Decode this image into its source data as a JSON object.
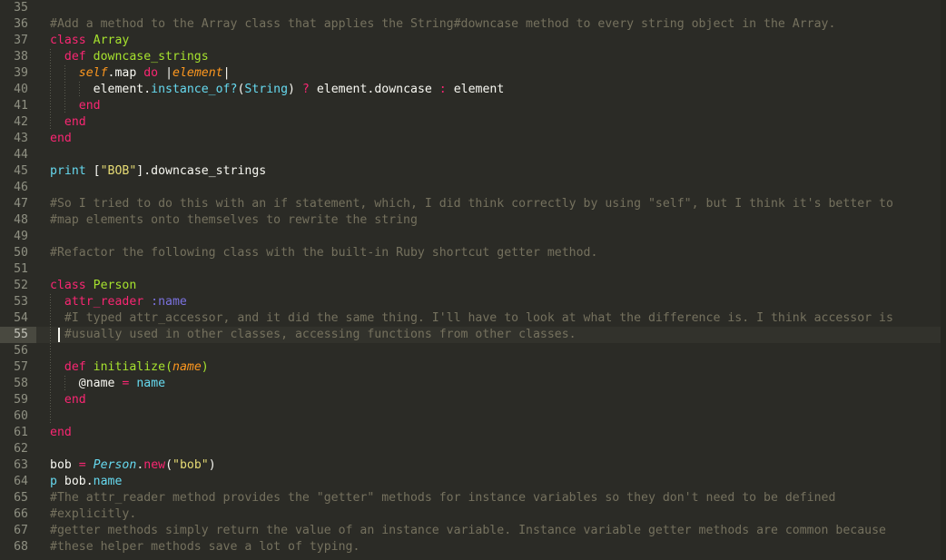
{
  "editor": {
    "theme_name": "monokai-dark",
    "background_color": "#2b2b26",
    "gutter_color": "#8f9082",
    "active_line_number": 55,
    "cursor_line": 55,
    "cursor_column": 2,
    "first_visible_line": 35,
    "last_visible_line": 68,
    "language": "ruby",
    "colors": {
      "comment": "#75715e",
      "keyword": "#f92672",
      "entity": "#a6e22e",
      "param": "#fd971f",
      "function": "#66d9ef",
      "string": "#e6db74",
      "symbol": "#7b72e0",
      "plain": "#f8f8f2",
      "active_line_bg": "#32322c",
      "active_gutter_bg": "#494940"
    }
  },
  "lines": [
    {
      "num": "35",
      "indent": 0,
      "active": false,
      "tokens": []
    },
    {
      "num": "36",
      "indent": 0,
      "active": false,
      "tokens": [
        {
          "t": "#Add a method to the Array class that applies the String#downcase method to every string object in the Array.",
          "c": "tok-comment"
        }
      ]
    },
    {
      "num": "37",
      "indent": 0,
      "active": false,
      "tokens": [
        {
          "t": "class ",
          "c": "tok-keyword"
        },
        {
          "t": "Array",
          "c": "tok-entity"
        }
      ]
    },
    {
      "num": "38",
      "indent": 1,
      "active": false,
      "tokens": [
        {
          "t": "  ",
          "c": "tok-plain"
        },
        {
          "t": "def ",
          "c": "tok-keyword"
        },
        {
          "t": "downcase_strings",
          "c": "tok-entity"
        }
      ]
    },
    {
      "num": "39",
      "indent": 2,
      "active": false,
      "tokens": [
        {
          "t": "    ",
          "c": "tok-plain"
        },
        {
          "t": "self",
          "c": "tok-param"
        },
        {
          "t": ".map ",
          "c": "tok-plain"
        },
        {
          "t": "do ",
          "c": "tok-keyword"
        },
        {
          "t": "|",
          "c": "tok-plain"
        },
        {
          "t": "element",
          "c": "tok-param"
        },
        {
          "t": "|",
          "c": "tok-plain"
        }
      ]
    },
    {
      "num": "40",
      "indent": 3,
      "active": false,
      "tokens": [
        {
          "t": "      element.",
          "c": "tok-plain"
        },
        {
          "t": "instance_of?",
          "c": "tok-func"
        },
        {
          "t": "(",
          "c": "tok-plain"
        },
        {
          "t": "String",
          "c": "tok-const"
        },
        {
          "t": ") ",
          "c": "tok-plain"
        },
        {
          "t": "?",
          "c": "tok-op"
        },
        {
          "t": " element.downcase ",
          "c": "tok-plain"
        },
        {
          "t": ":",
          "c": "tok-op"
        },
        {
          "t": " element",
          "c": "tok-plain"
        }
      ]
    },
    {
      "num": "41",
      "indent": 2,
      "active": false,
      "tokens": [
        {
          "t": "    ",
          "c": "tok-plain"
        },
        {
          "t": "end",
          "c": "tok-keyword"
        }
      ]
    },
    {
      "num": "42",
      "indent": 1,
      "active": false,
      "tokens": [
        {
          "t": "  ",
          "c": "tok-plain"
        },
        {
          "t": "end",
          "c": "tok-keyword"
        }
      ]
    },
    {
      "num": "43",
      "indent": 0,
      "active": false,
      "tokens": [
        {
          "t": "end",
          "c": "tok-keyword"
        }
      ]
    },
    {
      "num": "44",
      "indent": 0,
      "active": false,
      "tokens": []
    },
    {
      "num": "45",
      "indent": 0,
      "active": false,
      "tokens": [
        {
          "t": "print",
          "c": "tok-func"
        },
        {
          "t": " [",
          "c": "tok-plain"
        },
        {
          "t": "\"BOB\"",
          "c": "tok-string"
        },
        {
          "t": "].downcase_strings",
          "c": "tok-plain"
        }
      ]
    },
    {
      "num": "46",
      "indent": 0,
      "active": false,
      "tokens": []
    },
    {
      "num": "47",
      "indent": 0,
      "active": false,
      "tokens": [
        {
          "t": "#So I tried to do this with an if statement, which, I did think correctly by using \"self\", but I think it's better to",
          "c": "tok-comment"
        }
      ]
    },
    {
      "num": "48",
      "indent": 0,
      "active": false,
      "tokens": [
        {
          "t": "#map elements onto themselves to rewrite the string",
          "c": "tok-comment"
        }
      ]
    },
    {
      "num": "49",
      "indent": 0,
      "active": false,
      "tokens": []
    },
    {
      "num": "50",
      "indent": 0,
      "active": false,
      "tokens": [
        {
          "t": "#Refactor the following class with the built-in Ruby shortcut getter method.",
          "c": "tok-comment"
        }
      ]
    },
    {
      "num": "51",
      "indent": 0,
      "active": false,
      "tokens": []
    },
    {
      "num": "52",
      "indent": 0,
      "active": false,
      "tokens": [
        {
          "t": "class ",
          "c": "tok-keyword"
        },
        {
          "t": "Person",
          "c": "tok-entity"
        }
      ]
    },
    {
      "num": "53",
      "indent": 1,
      "active": false,
      "tokens": [
        {
          "t": "  ",
          "c": "tok-plain"
        },
        {
          "t": "attr_reader ",
          "c": "tok-keyword"
        },
        {
          "t": ":name",
          "c": "tok-symbol"
        }
      ]
    },
    {
      "num": "54",
      "indent": 1,
      "active": false,
      "tokens": [
        {
          "t": "  #I typed attr_accessor, and it did the same thing. I'll have to look at what the difference is. I think accessor is",
          "c": "tok-comment"
        }
      ]
    },
    {
      "num": "55",
      "indent": 1,
      "active": true,
      "tokens": [
        {
          "t": "  #usually used in other classes, accessing functions from other classes.",
          "c": "tok-comment"
        }
      ]
    },
    {
      "num": "56",
      "indent": 1,
      "active": false,
      "tokens": []
    },
    {
      "num": "57",
      "indent": 1,
      "active": false,
      "tokens": [
        {
          "t": "  ",
          "c": "tok-plain"
        },
        {
          "t": "def ",
          "c": "tok-keyword"
        },
        {
          "t": "initialize",
          "c": "tok-entity"
        },
        {
          "t": "(",
          "c": "tok-entity"
        },
        {
          "t": "name",
          "c": "tok-param"
        },
        {
          "t": ")",
          "c": "tok-entity"
        }
      ]
    },
    {
      "num": "58",
      "indent": 2,
      "active": false,
      "tokens": [
        {
          "t": "    @name ",
          "c": "tok-plain"
        },
        {
          "t": "=",
          "c": "tok-op"
        },
        {
          "t": " ",
          "c": "tok-plain"
        },
        {
          "t": "name",
          "c": "tok-cyan"
        }
      ]
    },
    {
      "num": "59",
      "indent": 1,
      "active": false,
      "tokens": [
        {
          "t": "  ",
          "c": "tok-plain"
        },
        {
          "t": "end",
          "c": "tok-keyword"
        }
      ]
    },
    {
      "num": "60",
      "indent": 1,
      "active": false,
      "tokens": []
    },
    {
      "num": "61",
      "indent": 0,
      "active": false,
      "tokens": [
        {
          "t": "end",
          "c": "tok-keyword"
        }
      ]
    },
    {
      "num": "62",
      "indent": 0,
      "active": false,
      "tokens": []
    },
    {
      "num": "63",
      "indent": 0,
      "active": false,
      "tokens": [
        {
          "t": "bob ",
          "c": "tok-plain"
        },
        {
          "t": "=",
          "c": "tok-op"
        },
        {
          "t": " ",
          "c": "tok-plain"
        },
        {
          "t": "Person",
          "c": "tok-type"
        },
        {
          "t": ".",
          "c": "tok-plain"
        },
        {
          "t": "new",
          "c": "tok-op"
        },
        {
          "t": "(",
          "c": "tok-plain"
        },
        {
          "t": "\"bob\"",
          "c": "tok-string"
        },
        {
          "t": ")",
          "c": "tok-plain"
        }
      ]
    },
    {
      "num": "64",
      "indent": 0,
      "active": false,
      "tokens": [
        {
          "t": "p",
          "c": "tok-func"
        },
        {
          "t": " bob.",
          "c": "tok-plain"
        },
        {
          "t": "name",
          "c": "tok-cyan"
        }
      ]
    },
    {
      "num": "65",
      "indent": 0,
      "active": false,
      "tokens": [
        {
          "t": "#The attr_reader method provides the \"getter\" methods for instance variables so they don't need to be defined",
          "c": "tok-comment"
        }
      ]
    },
    {
      "num": "66",
      "indent": 0,
      "active": false,
      "tokens": [
        {
          "t": "#explicitly.",
          "c": "tok-comment"
        }
      ]
    },
    {
      "num": "67",
      "indent": 0,
      "active": false,
      "tokens": [
        {
          "t": "#getter methods simply return the value of an instance variable. Instance variable getter methods are common because",
          "c": "tok-comment"
        }
      ]
    },
    {
      "num": "68",
      "indent": 0,
      "active": false,
      "tokens": [
        {
          "t": "#these helper methods save a lot of typing.",
          "c": "tok-comment"
        }
      ]
    }
  ]
}
